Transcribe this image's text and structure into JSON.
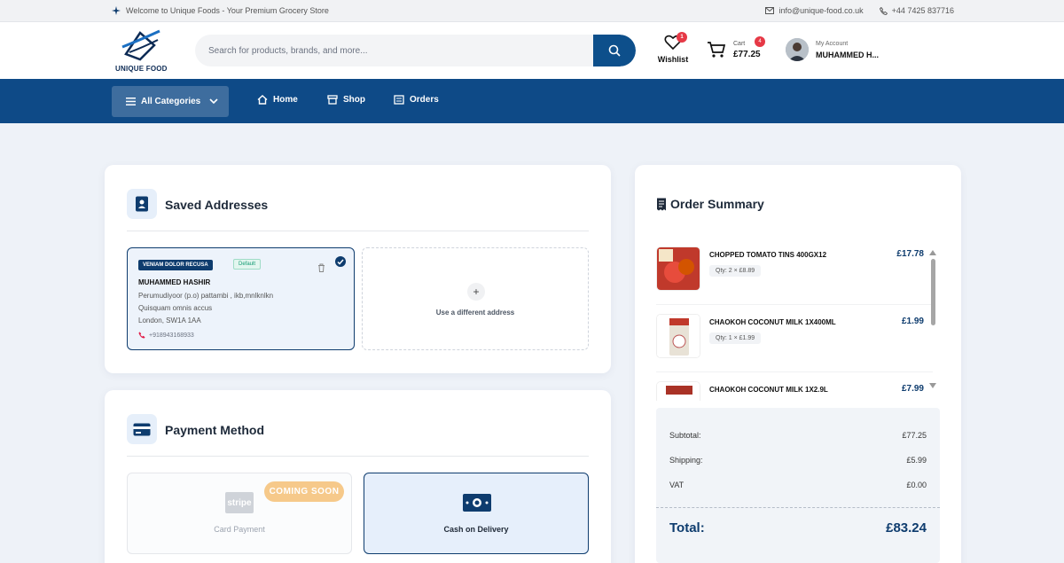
{
  "topbar": {
    "welcome": "Welcome to Unique Foods - Your Premium Grocery Store",
    "email": "info@unique-food.co.uk",
    "phone": "+44 7425 837716"
  },
  "header": {
    "logo_text": "UNIQUE FOOD",
    "search_placeholder": "Search for products, brands, and more...",
    "wishlist_label": "Wishlist",
    "wishlist_count": "1",
    "cart_label": "Cart",
    "cart_total": "£77.25",
    "cart_count": "4",
    "account_label": "My Account",
    "account_name": "MUHAMMED H..."
  },
  "nav": {
    "all_categories": "All Categories",
    "links": [
      "Home",
      "Shop",
      "Orders"
    ]
  },
  "addresses": {
    "title": "Saved Addresses",
    "saved": {
      "tag": "VENIAM DOLOR RECUSA",
      "default_tag": "Default",
      "name": "MUHAMMED HASHIR",
      "line1": "Perumudiyoor (p.o) pattambi , ikb,mnlknlkn",
      "line2": "Quisquam omnis accus",
      "line3": "London, SW1A 1AA",
      "phone": "+918943168933"
    },
    "new_label": "Use a different address"
  },
  "payment": {
    "title": "Payment Method",
    "card_label": "Card Payment",
    "coming_soon": "COMING SOON",
    "stripe_logo": "stripe",
    "cash_label": "Cash on Delivery"
  },
  "order_summary": {
    "title": "Order Summary",
    "items": [
      {
        "name": "CHOPPED TOMATO TINS 400GX12",
        "qty": "Qty: 2 × £8.89",
        "price": "£17.78"
      },
      {
        "name": "CHAOKOH COCONUT MILK 1X400ML",
        "qty": "Qty: 1 × £1.99",
        "price": "£1.99"
      },
      {
        "name": "CHAOKOH COCONUT MILK 1X2.9L",
        "qty": "",
        "price": "£7.99"
      }
    ],
    "subtotal_label": "Subtotal:",
    "subtotal": "£77.25",
    "shipping_label": "Shipping:",
    "shipping": "£5.99",
    "vat_label": "VAT",
    "vat": "£0.00",
    "total_label": "Total:",
    "total": "£83.24"
  },
  "colors": {
    "primary": "#0e4a87",
    "dark_blue": "#0e3c6e",
    "badge_red": "#e63946",
    "coming_soon": "#f6c98a"
  }
}
